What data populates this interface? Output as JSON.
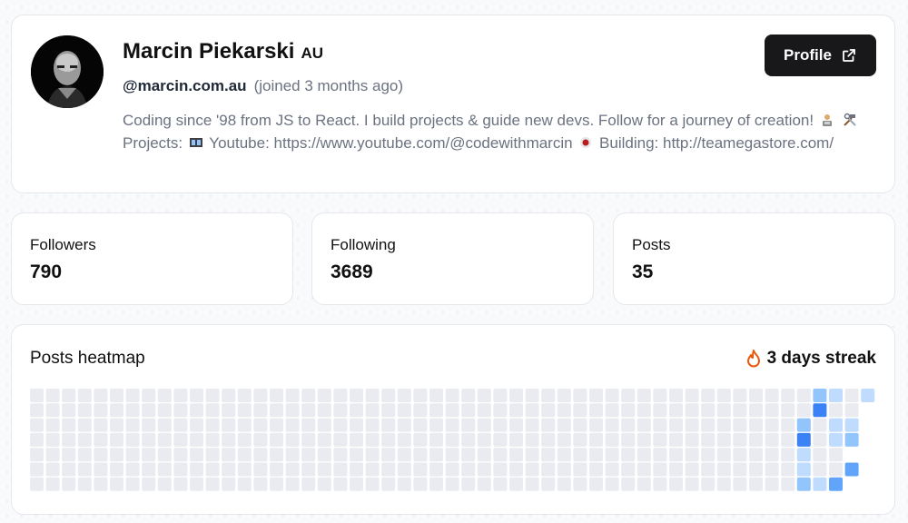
{
  "profile": {
    "name": "Marcin Piekarski",
    "country": "AU",
    "handle": "@marcin.com.au",
    "joined": "(joined 3 months ago)",
    "bio_part1": "Coding since '98 from JS to React. I build projects & guide new devs. Follow for a journey of creation!",
    "bio_part2": "Projects:",
    "bio_part3": "Youtube: https://www.youtube.com/@codewithmarcin",
    "bio_part4": "Building:",
    "bio_part5": "http://teamegastore.com/",
    "button_label": "Profile"
  },
  "stats": {
    "followers_label": "Followers",
    "followers_value": "790",
    "following_label": "Following",
    "following_value": "3689",
    "posts_label": "Posts",
    "posts_value": "35"
  },
  "heatmap": {
    "title": "Posts heatmap",
    "streak_label": "3 days streak",
    "weeks": 53,
    "days": 7,
    "colors": [
      "#e9ebf0",
      "#bfdbfe",
      "#93c5fd",
      "#60a5fa",
      "#3b82f6"
    ],
    "active": [
      [
        49,
        0,
        2
      ],
      [
        50,
        0,
        1
      ],
      [
        52,
        0,
        1
      ],
      [
        49,
        1,
        4
      ],
      [
        48,
        2,
        2
      ],
      [
        50,
        2,
        1
      ],
      [
        51,
        2,
        1
      ],
      [
        48,
        3,
        4
      ],
      [
        50,
        3,
        1
      ],
      [
        51,
        3,
        2
      ],
      [
        48,
        4,
        1
      ],
      [
        48,
        5,
        1
      ],
      [
        51,
        5,
        3
      ],
      [
        48,
        6,
        2
      ],
      [
        49,
        6,
        1
      ],
      [
        50,
        6,
        3
      ]
    ],
    "empty_tail": [
      [
        51,
        4
      ],
      [
        51,
        6
      ],
      [
        52,
        1
      ],
      [
        52,
        2
      ],
      [
        52,
        3
      ],
      [
        52,
        4
      ],
      [
        52,
        5
      ],
      [
        52,
        6
      ]
    ]
  }
}
